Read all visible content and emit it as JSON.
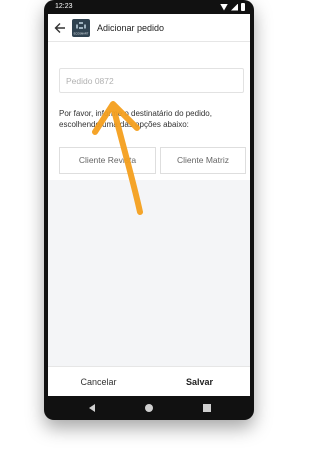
{
  "status_bar": {
    "time": "12:23"
  },
  "app_bar": {
    "title": "Adicionar pedido",
    "logo_text": "ECOSMART"
  },
  "form": {
    "order_placeholder": "Pedido 0872",
    "instructions": "Por favor, informe o destinatário do pedido, escolhendo uma das opções abaixo:",
    "options": [
      {
        "label": "Cliente Revista"
      },
      {
        "label": "Cliente Matriz"
      }
    ]
  },
  "footer": {
    "cancel_label": "Cancelar",
    "save_label": "Salvar"
  },
  "colors": {
    "annotation_arrow": "#f5a01e",
    "logo_background": "#2f4250"
  }
}
